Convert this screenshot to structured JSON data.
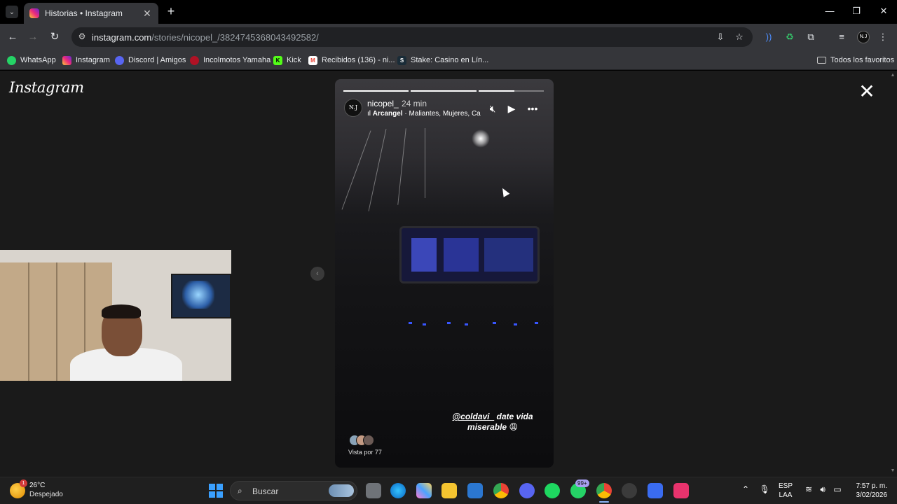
{
  "browser": {
    "tab_title": "Historias • Instagram",
    "url_host": "instagram.com",
    "url_path": "/stories/nicopel_/3824745368043492582/",
    "new_tab_symbol": "+",
    "tab_close_symbol": "✕",
    "window_controls": [
      "—",
      "❐",
      "✕"
    ]
  },
  "bookmarks": [
    {
      "label": "WhatsApp",
      "color": "#25d366"
    },
    {
      "label": "Instagram",
      "color": "#e1306c"
    },
    {
      "label": "Discord | Amigos",
      "color": "#5865f2"
    },
    {
      "label": "Incolmotos Yamaha",
      "color": "#b01225"
    },
    {
      "label": "Kick",
      "color": "#53fc18"
    },
    {
      "label": "Recibidos (136) - ni...",
      "color": "#ea4335"
    },
    {
      "label": "Stake: Casino en Lín...",
      "color": "#1a2c38"
    }
  ],
  "all_bookmarks": "Todos los favoritos",
  "page": {
    "logo": "Instagram",
    "close_symbol": "✕"
  },
  "story": {
    "avatar_text": "N.J",
    "username": "nicopel_",
    "time": "24 min",
    "music_artist": "Arcangel",
    "music_rest": " · Maliantes, Mujeres, Ca",
    "mention": "@coldavi_",
    "caption_rest": " date vida miserable",
    "caption_emoji": "😩",
    "views": "Vista por 77",
    "progress_segments": [
      "done",
      "done",
      "partial"
    ]
  },
  "taskbar": {
    "temperature": "26°C",
    "condition": "Despejado",
    "weather_badge": "1",
    "search_label": "Buscar",
    "whatsapp_badge": "99+",
    "lang_line1": "ESP",
    "lang_line2": "LAA",
    "time": "7:57 p. m.",
    "date": "3/02/2026"
  }
}
